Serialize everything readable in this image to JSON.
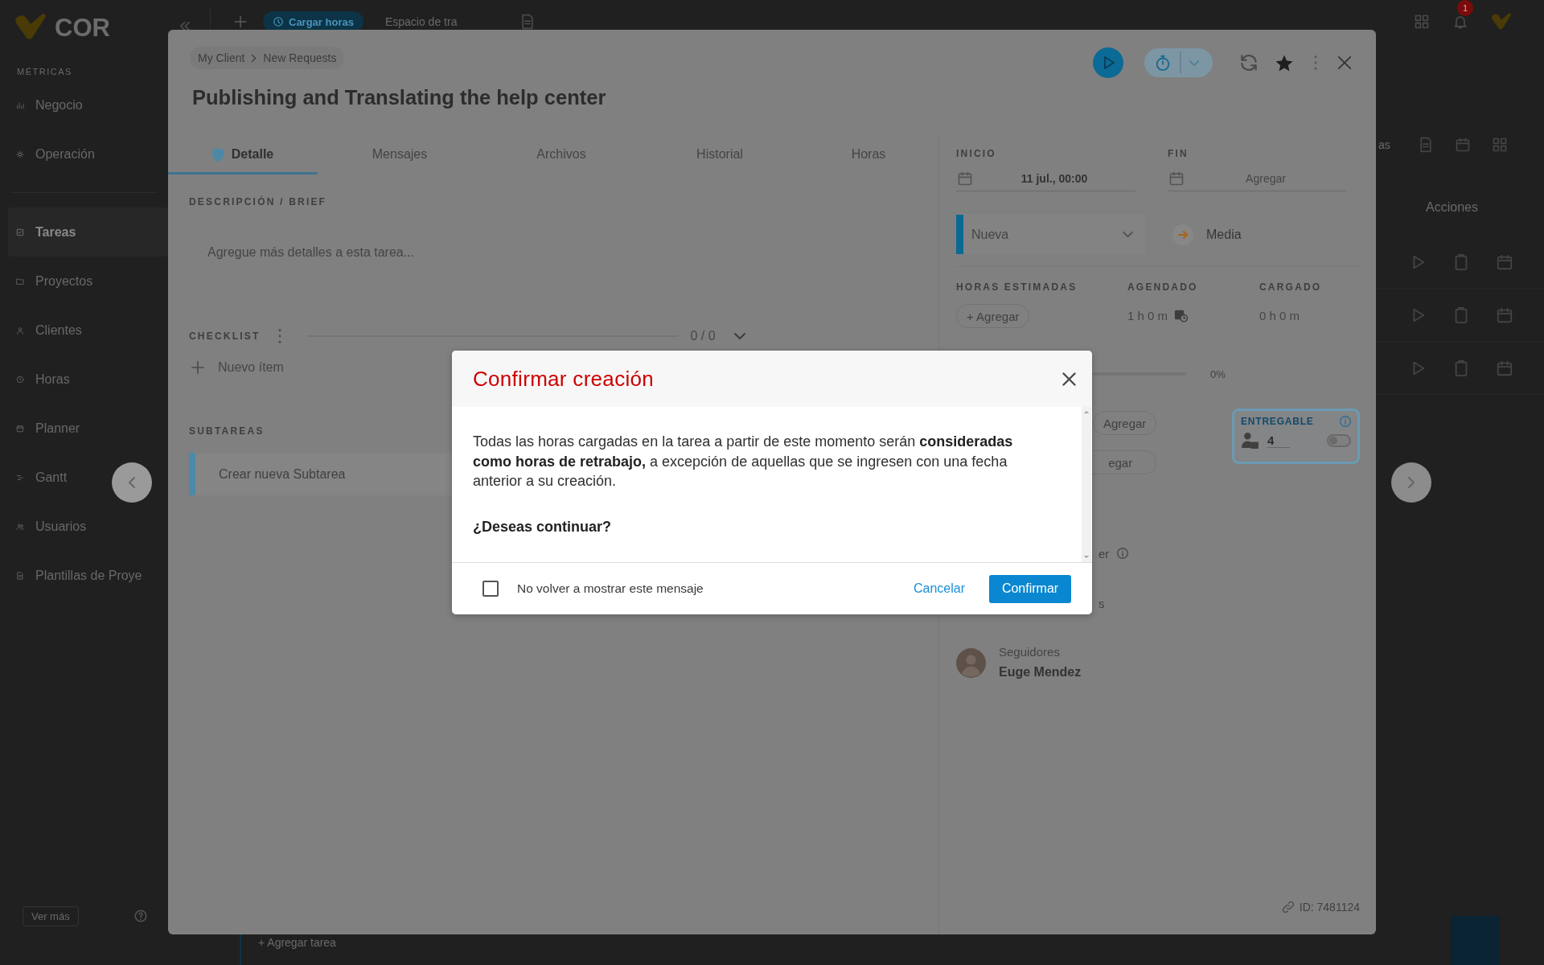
{
  "app": {
    "logo": "COR",
    "sidebar": {
      "heading": "MÉTRICAS",
      "groups": [
        {
          "items": [
            {
              "label": "Negocio",
              "selected": false
            },
            {
              "label": "Operación",
              "selected": false
            }
          ]
        },
        {
          "items": [
            {
              "label": "Tareas",
              "selected": true
            },
            {
              "label": "Proyectos",
              "selected": false
            },
            {
              "label": "Clientes",
              "selected": false
            },
            {
              "label": "Horas",
              "selected": false
            },
            {
              "label": "Planner",
              "selected": false
            },
            {
              "label": "Gantt",
              "selected": false
            },
            {
              "label": "Usuarios",
              "selected": false
            },
            {
              "label": "Plantillas de Proye",
              "selected": false
            }
          ]
        }
      ],
      "footer": "Ver más"
    },
    "top_bar": {
      "button": "Cargar horas",
      "workspace": "Espacio de tra",
      "notifications": "1"
    },
    "content": {
      "fragment": "as",
      "column": "Acciones",
      "add_task": "+ Agregar tarea"
    }
  },
  "task": {
    "breadcrumb": [
      "My Client",
      "New Requests"
    ],
    "title": "Publishing and Translating the help center",
    "tabs": [
      {
        "label": "Detalle",
        "kind": "icon",
        "selected": true
      },
      {
        "label": "Mensajes",
        "kind": "text",
        "selected": false
      },
      {
        "label": "Archivos",
        "kind": "text",
        "selected": false
      },
      {
        "label": "Historial",
        "kind": "text",
        "selected": false
      },
      {
        "label": "Horas",
        "kind": "text",
        "selected": false
      }
    ],
    "description": {
      "label": "DESCRIPCIÓN / BRIEF",
      "placeholder": "Agregue más detalles a esta tarea..."
    },
    "checklist": {
      "label": "CHECKLIST",
      "level": 0,
      "count": "0 / 0",
      "add": "Nuevo ítem"
    },
    "subtasks": {
      "label": "SUBTAREAS",
      "placeholder": "Crear nueva Subtarea"
    },
    "dates": [
      {
        "label": "INICIO",
        "value": "11 jul., 00:00"
      },
      {
        "label": "FIN",
        "placeholder": "Agregar"
      }
    ],
    "status": "Nueva",
    "priority": "Media",
    "hours": [
      {
        "label": "HORAS ESTIMADAS",
        "kind": "button",
        "value": "+ Agregar"
      },
      {
        "label": "AGENDADO",
        "kind": "scheduled",
        "value": "1 h 0 m"
      },
      {
        "label": "CARGADO",
        "kind": "text",
        "value": "0 h 0 m"
      }
    ],
    "progress": {
      "level": 0,
      "reading": "0%"
    },
    "add_buttons": [
      "Agregar",
      "egar"
    ],
    "deliverable": {
      "label": "ENTREGABLE",
      "value": "4",
      "on": false
    },
    "partial_labels": [
      "er",
      "s"
    ],
    "followers": {
      "label": "Seguidores",
      "name": "Euge Mendez"
    },
    "id": "ID: 7481124"
  },
  "dialog": {
    "title": "Confirmar creación",
    "message": "Todas las horas cargadas en la tarea a partir de este momento serán **consideradas como horas de retrabajo,** a excepción de aquellas que se ingresen con una fecha anterior a su creación.",
    "question": "¿Deseas continuar?",
    "dont_show": {
      "label": "No volver a mostrar este mensaje",
      "checked": false
    },
    "buttons": [
      {
        "label": "Cancelar",
        "kind": "link"
      },
      {
        "label": "Confirmar",
        "kind": "primary"
      }
    ]
  }
}
